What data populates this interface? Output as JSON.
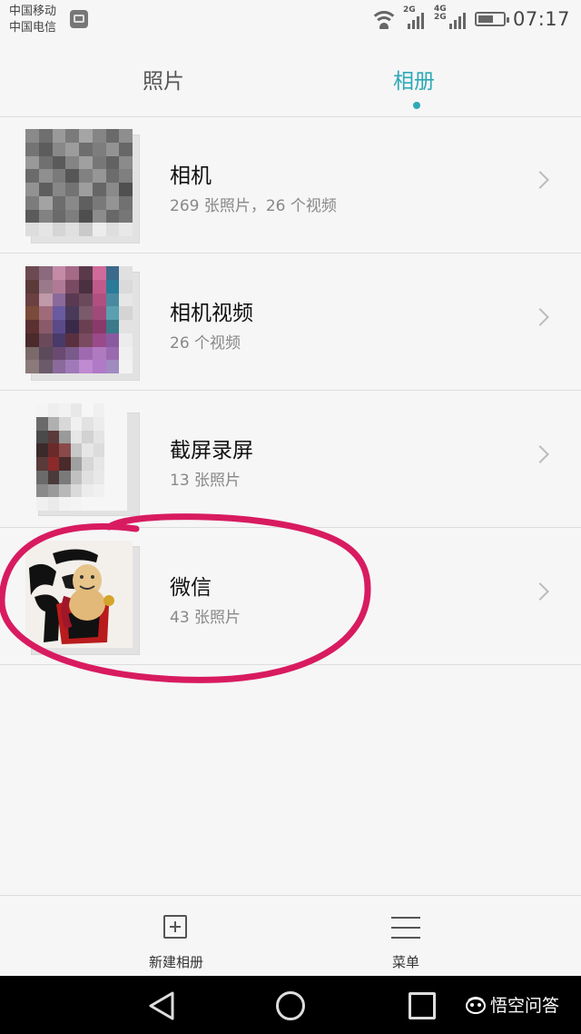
{
  "status_bar": {
    "carrier_1": "中国移动",
    "carrier_2": "中国电信",
    "network_1": "2G",
    "network_2a": "4G",
    "network_2b": "2G",
    "time": "07:17",
    "battery_level": 0.6
  },
  "tabs": [
    {
      "label": "照片",
      "active": false
    },
    {
      "label": "相册",
      "active": true
    }
  ],
  "albums": [
    {
      "name": "相机",
      "count": "269 张照片，26 个视频"
    },
    {
      "name": "相机视频",
      "count": "26 个视频"
    },
    {
      "name": "截屏录屏",
      "count": "13 张照片"
    },
    {
      "name": "微信",
      "count": "43 张照片"
    }
  ],
  "toolbar": {
    "new_album_label": "新建相册",
    "menu_label": "菜单"
  },
  "watermark": "悟空问答",
  "colors": {
    "accent": "#2fa9b7",
    "highlight_circle": "#d81b60",
    "background": "#f6f6f6"
  }
}
